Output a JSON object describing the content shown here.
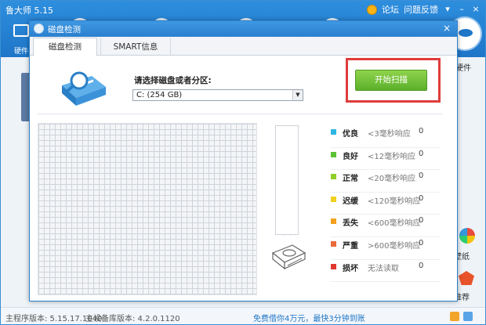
{
  "app": {
    "title": "鲁大师 5.15",
    "top_links": {
      "forum": "论坛",
      "feedback": "问题反馈"
    },
    "left_tab_label": "硬件",
    "right_side": {
      "hardware_label": "硬件",
      "wallpaper_label": "壁纸",
      "recommend_label": "推荐"
    },
    "status_bar": {
      "program_version": "主程序版本: 5.15.17.1040",
      "db_version": "主设备库版本: 4.2.0.1120",
      "promo": "免费借你4万元，最快3分钟到账"
    }
  },
  "dialog": {
    "title": "磁盘检测",
    "close_glyph": "×",
    "tabs": [
      {
        "label": "磁盘检测",
        "active": true
      },
      {
        "label": "SMART信息",
        "active": false
      }
    ],
    "select_label": "请选择磁盘或者分区:",
    "selected_disk": "C:  (254 GB)",
    "scan_button_label": "开始扫描",
    "highlight_color": "#e03c3c",
    "progress_fraction": 0,
    "legend": [
      {
        "name": "优良",
        "desc": "<3毫秒响应",
        "count": "0",
        "color": "#2db6e3"
      },
      {
        "name": "良好",
        "desc": "<12毫秒响应",
        "count": "0",
        "color": "#5bc236"
      },
      {
        "name": "正常",
        "desc": "<20毫秒响应",
        "count": "0",
        "color": "#8fcf2a"
      },
      {
        "name": "迟缓",
        "desc": "<120毫秒响应",
        "count": "0",
        "color": "#f1d01b"
      },
      {
        "name": "丢失",
        "desc": "<600毫秒响应",
        "count": "0",
        "color": "#f3a01c"
      },
      {
        "name": "严重",
        "desc": ">600毫秒响应",
        "count": "0",
        "color": "#ea6a3a"
      },
      {
        "name": "损坏",
        "desc": "无法读取",
        "count": "0",
        "color": "#e0362c"
      }
    ]
  },
  "icons": {
    "app_icon": "disk-check-icon",
    "disk_illustration": "magnifier-disk-icon",
    "hdd_icon": "hard-drive-icon",
    "close": "close-icon"
  }
}
